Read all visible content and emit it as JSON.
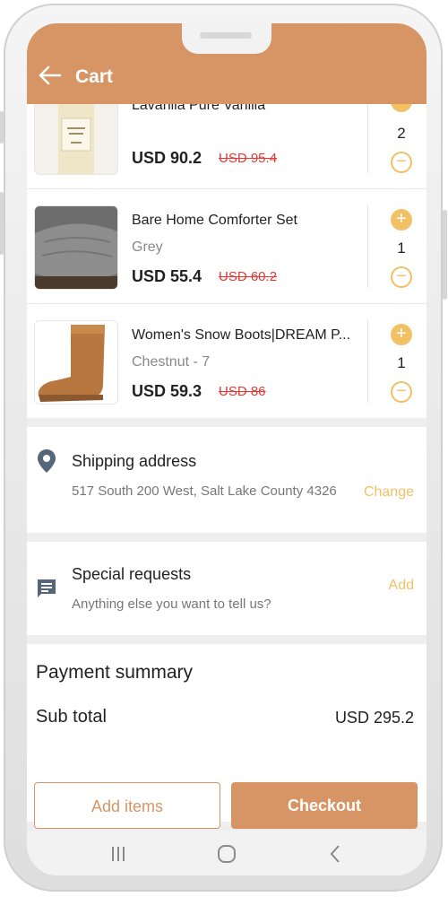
{
  "header": {
    "title": "Cart"
  },
  "items": [
    {
      "name": "Lavanila Pure Vanilla",
      "variant": "",
      "price": "USD 90.2",
      "old_price": "USD 95.4",
      "qty": "2"
    },
    {
      "name": "Bare Home Comforter Set",
      "variant": "Grey",
      "price": "USD 55.4",
      "old_price": "USD 60.2",
      "qty": "1"
    },
    {
      "name": "Women's Snow Boots|DREAM P...",
      "variant": "Chestnut - 7",
      "price": "USD 59.3",
      "old_price": "USD 86",
      "qty": "1"
    }
  ],
  "shipping": {
    "title": "Shipping address",
    "address": "517 South 200 West, Salt Lake County 4326",
    "action": "Change"
  },
  "requests": {
    "title": "Special requests",
    "subtitle": "Anything else you want to tell us?",
    "action": "Add"
  },
  "summary": {
    "title": "Payment summary",
    "subtotal_label": "Sub total",
    "subtotal_value": "USD 295.2"
  },
  "buttons": {
    "add_items": "Add items",
    "checkout": "Checkout"
  },
  "colors": {
    "accent": "#d79565",
    "highlight": "#f2c166",
    "strike": "#e53935"
  },
  "icons": {
    "back": "arrow-left-icon",
    "location": "location-pin-icon",
    "chat": "chat-icon",
    "nav_recents": "recents-icon",
    "nav_home": "home-icon",
    "nav_back": "back-icon"
  }
}
